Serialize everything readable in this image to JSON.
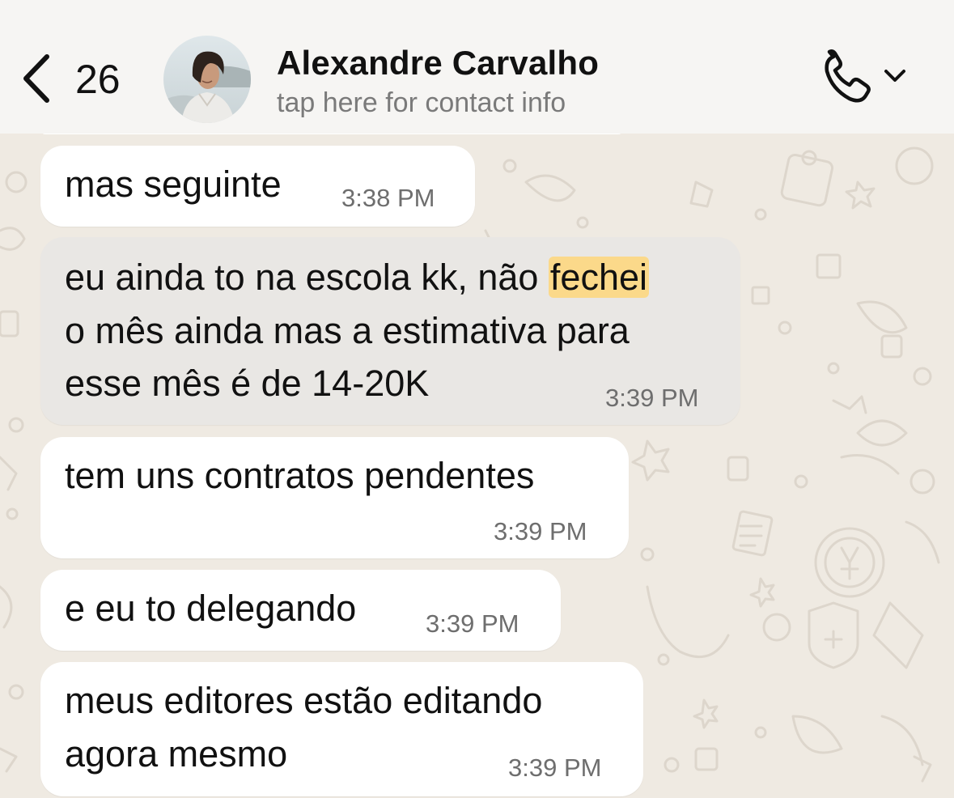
{
  "header": {
    "back_count": "26",
    "contact_name": "Alexandre Carvalho",
    "contact_subtitle": "tap here for contact info",
    "icons": {
      "back": "chevron-left-icon",
      "call": "phone-icon",
      "call_menu": "chevron-down-icon"
    }
  },
  "messages": [
    {
      "text": "mas seguinte",
      "time": "3:38 PM"
    },
    {
      "text_before": "eu ainda to na escola kk, não ",
      "highlight": "fechei",
      "line2": "o mês ainda mas a estimativa para",
      "line3": "esse mês é de 14-20K",
      "time": "3:39 PM",
      "selected": true
    },
    {
      "text": "tem uns contratos pendentes",
      "time": "3:39 PM"
    },
    {
      "text": "e eu to delegando",
      "time": "3:39 PM"
    },
    {
      "line1": "meus editores estão editando",
      "line2": "agora mesmo",
      "time": "3:39 PM"
    }
  ],
  "colors": {
    "header_bg": "#f6f5f3",
    "chat_bg": "#efeae2",
    "bubble": "#ffffff",
    "bubble_selected": "#e9e7e4",
    "highlight": "#fbd98a",
    "timestamp": "#6e6e6e",
    "subtitle": "#7a7a7a"
  }
}
